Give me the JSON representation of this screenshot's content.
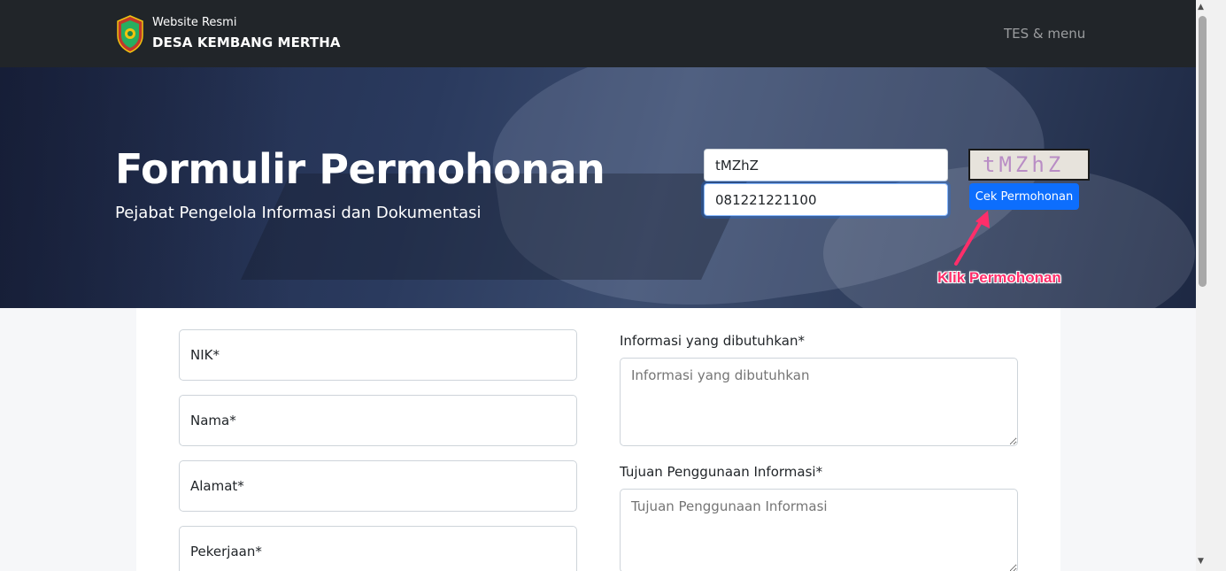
{
  "navbar": {
    "brand_small": "Website Resmi",
    "brand_big": "DESA KEMBANG MERTHA",
    "menu_label": "TES & menu",
    "logo_icon": "village-emblem-icon"
  },
  "hero": {
    "title": "Formulir Permohonan",
    "subtitle": "Pejabat Pengelola Informasi dan Dokumentasi",
    "check_code_value": "tMZhZ",
    "check_phone_value": "081221221100",
    "captcha_text": "tMZhZ",
    "check_button_label": "Cek Permohonan",
    "annotation": "Klik Permohonan",
    "annotation_color": "#ff2e6a",
    "button_color": "#0d6efd"
  },
  "form": {
    "fields": [
      {
        "label": "NIK*"
      },
      {
        "label": "Nama*"
      },
      {
        "label": "Alamat*"
      },
      {
        "label": "Pekerjaan*"
      }
    ],
    "info_label": "Informasi yang dibutuhkan*",
    "info_placeholder": "Informasi yang dibutuhkan",
    "purpose_label": "Tujuan Penggunaan Informasi*",
    "purpose_placeholder": "Tujuan Penggunaan Informasi"
  }
}
